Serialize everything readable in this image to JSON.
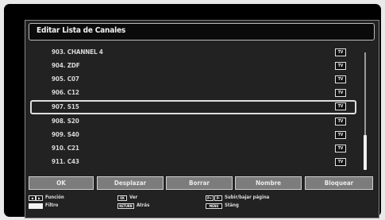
{
  "title": "Editar Lista de Canales",
  "channels": [
    {
      "label": "903. CHANNEL 4",
      "badge": "TV"
    },
    {
      "label": "904. ZDF",
      "badge": "TV"
    },
    {
      "label": "905. C07",
      "badge": "TV"
    },
    {
      "label": "906. C12",
      "badge": "TV"
    },
    {
      "label": "907. S15",
      "badge": "TV",
      "selected": true
    },
    {
      "label": "908. S20",
      "badge": "TV"
    },
    {
      "label": "909. S40",
      "badge": "TV"
    },
    {
      "label": "910. C21",
      "badge": "TV"
    },
    {
      "label": "911. C43",
      "badge": "TV"
    }
  ],
  "functions": [
    "OK",
    "Desplazar",
    "Borrar",
    "Nombre",
    "Bloquear"
  ],
  "legend": {
    "funcion": "Función",
    "filtro": "Filtro",
    "ok_key": "OK",
    "ver": "Ver",
    "return_key": "RETURN",
    "atras": "Atrás",
    "page": "Subir/bajar página",
    "menu_key": "MENU",
    "stang": "Stäng",
    "page_key_up": "P+",
    "page_key_down": "P-"
  },
  "colors": {
    "accent_bar": "#7c7c7c",
    "highlight": "#dedede"
  }
}
